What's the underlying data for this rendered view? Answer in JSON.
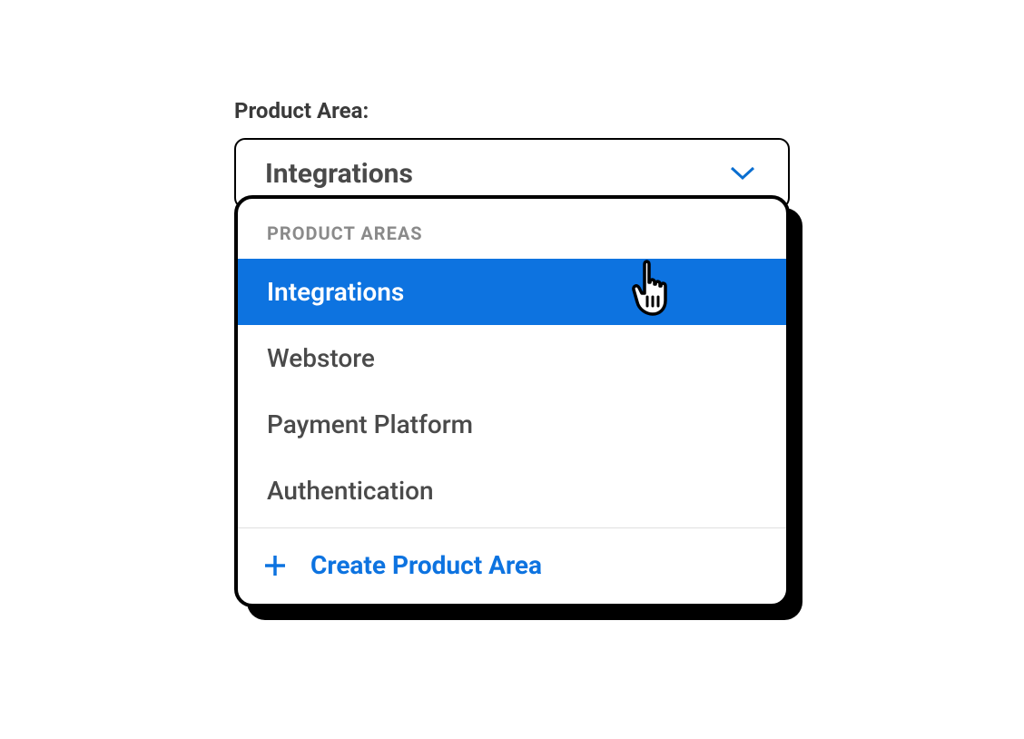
{
  "field": {
    "label": "Product Area:",
    "selected": "Integrations"
  },
  "dropdown": {
    "header": "PRODUCT AREAS",
    "items": [
      {
        "label": "Integrations",
        "selected": true
      },
      {
        "label": "Webstore",
        "selected": false
      },
      {
        "label": "Payment Platform",
        "selected": false
      },
      {
        "label": "Authentication",
        "selected": false
      }
    ],
    "create_label": "Create Product Area"
  },
  "colors": {
    "accent": "#0d73e0",
    "text": "#4a4a4a",
    "muted": "#8a8a8a"
  }
}
